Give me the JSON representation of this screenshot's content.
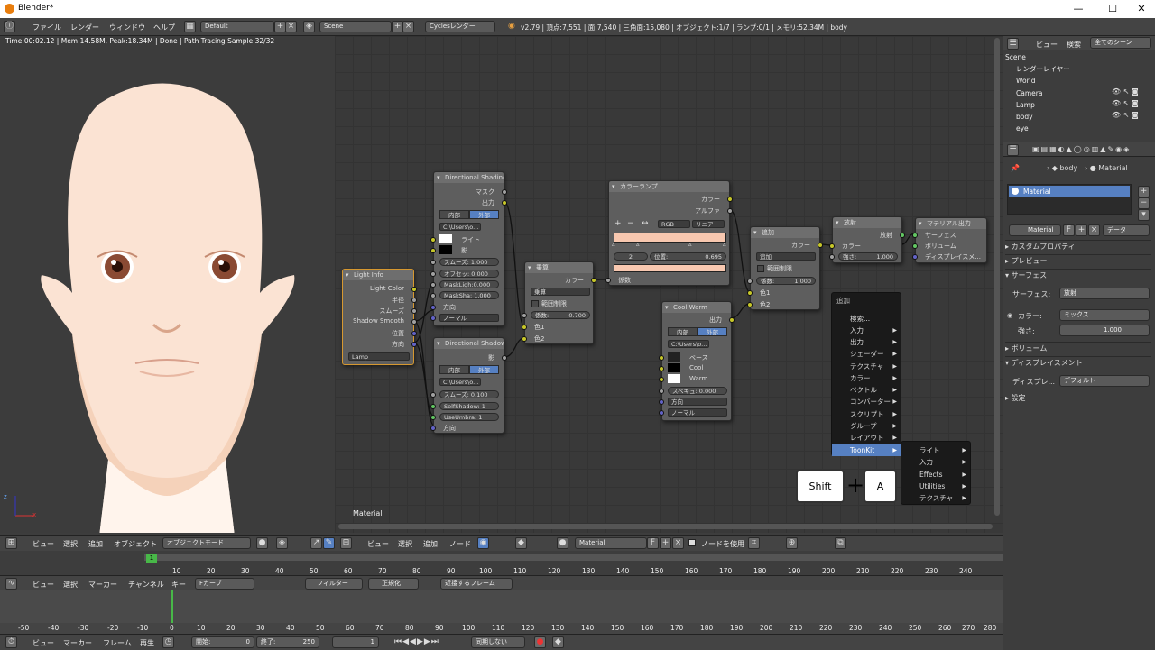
{
  "window": {
    "title": "Blender*",
    "minimize": "—",
    "maximize": "☐",
    "close": "✕"
  },
  "topbar": {
    "menus": [
      "ファイル",
      "レンダー",
      "ウィンドウ",
      "ヘルプ"
    ],
    "layout": "Default",
    "scene": "Scene",
    "engine": "Cyclesレンダー",
    "stats": "v2.79 | 頂点:7,551 | 面:7,540 | 三角面:15,080 | オブジェクト:1/7 | ランプ:0/1 | メモリ:52.34M | body"
  },
  "viewport": {
    "info": "Time:00:02.12 | Mem:14.58M, Peak:18.34M | Done | Path Tracing Sample 32/32",
    "axis_x": "x",
    "axis_z": "z"
  },
  "nodeeditor": {
    "label": "Material"
  },
  "nodes": {
    "dir_shading": {
      "title": "Directional Shading",
      "out1": "マスク",
      "out2": "出力",
      "tab_in": "内部",
      "tab_ext": "外部",
      "path": "C:\\Users\\o...",
      "light": "ライト",
      "shadow": "影",
      "f1": "スムーズ: 1.000",
      "f2": "オフセッ: 0.000",
      "f3": "MaskLigh:0.000",
      "f4": "MaskSha: 1.000",
      "dir": "方向",
      "normal": "ノーマル"
    },
    "light_info": {
      "title": "Light Info",
      "o1": "Light Color",
      "o2": "半径",
      "o3": "スムーズ",
      "o4": "Shadow Smooth",
      "o5": "位置",
      "o6": "方向",
      "lamp": "Lamp"
    },
    "dir_shadow": {
      "title": "Directional Shadow",
      "out": "影",
      "tab_in": "内部",
      "tab_ext": "外部",
      "path": "C:\\Users\\o...",
      "f1": "スムーズ: 0.100",
      "f2": "SelfShadow: 1",
      "f3": "UseUmbra: 1",
      "dir": "方向"
    },
    "multiply": {
      "title": "乗算",
      "out": "カラー",
      "mode": "乗算",
      "clamp": "範囲制限",
      "fac_label": "係数:",
      "fac": "0.700",
      "c1": "色1",
      "c2": "色2"
    },
    "ramp": {
      "title": "カラーランプ",
      "o1": "カラー",
      "o2": "アルファ",
      "mode": "RGB",
      "interp": "リニア",
      "idx": "2",
      "pos": "位置:",
      "posval": "0.695",
      "fac": "係数"
    },
    "coolwarm": {
      "title": "Cool Warm",
      "out": "出力",
      "tab_in": "内部",
      "tab_ext": "外部",
      "path": "C:\\Users\\o...",
      "base": "ベース",
      "cool": "Cool",
      "warm": "Warm",
      "spec": "スペキュ: 0.000",
      "dir": "方向",
      "normal": "ノーマル"
    },
    "add": {
      "title": "追加",
      "out": "カラー",
      "mode": "追加",
      "clamp": "範囲制限",
      "fac": "係数:",
      "facval": "1.000",
      "c1": "色1",
      "c2": "色2"
    },
    "emission": {
      "title": "放射",
      "out": "放射",
      "color": "カラー",
      "str": "強さ:",
      "strval": "1.000"
    },
    "matout": {
      "title": "マテリアル出力",
      "i1": "サーフェス",
      "i2": "ボリューム",
      "i3": "ディスプレイスメ..."
    }
  },
  "addmenu": {
    "title": "追加",
    "items": [
      "検索...",
      "入力",
      "出力",
      "シェーダー",
      "テクスチャ",
      "カラー",
      "ベクトル",
      "コンバーター",
      "スクリプト",
      "グループ",
      "レイアウト",
      "ToonKit"
    ]
  },
  "submenu": {
    "items": [
      "ライト",
      "入力",
      "Effects",
      "Utilities",
      "テクスチャ"
    ]
  },
  "keys": {
    "shift": "Shift",
    "plus": "+",
    "a": "A"
  },
  "outliner": {
    "tabs": [
      "ビュー",
      "検索",
      "全てのシーン"
    ],
    "rows": [
      "Scene",
      "レンダーレイヤー",
      "World",
      "Camera",
      "Lamp",
      "body",
      "eye"
    ]
  },
  "properties": {
    "bc1": "body",
    "bc2": "Material",
    "slot": "Material",
    "matname": "Material",
    "F": "F",
    "data": "データ",
    "panels": [
      "カスタムプロパティ",
      "プレビュー",
      "サーフェス",
      "ボリューム",
      "ディスプレイスメント"
    ],
    "surface_label": "サーフェス:",
    "surface_val": "放射",
    "color_label": "カラー:",
    "color_val": "ミックス",
    "str_label": "強さ:",
    "str_val": "1.000",
    "disp_label": "ディスプレ...",
    "disp_val": "デフォルト"
  },
  "vpheader": {
    "items": [
      "ビュー",
      "選択",
      "追加",
      "オブジェクト"
    ],
    "mode": "オブジェクトモード"
  },
  "neheader": {
    "items": [
      "ビュー",
      "選択",
      "追加",
      "ノード"
    ],
    "mat": "Material",
    "F": "F",
    "use_nodes": "ノードを使用"
  },
  "timeline": {
    "frame": "1",
    "ticks": [
      "10",
      "20",
      "30",
      "40",
      "50",
      "60",
      "70",
      "80",
      "90",
      "100",
      "110",
      "120",
      "130",
      "140",
      "150",
      "160",
      "170",
      "180",
      "190",
      "200",
      "210",
      "220",
      "230",
      "240"
    ]
  },
  "graph": {
    "items": [
      "ビュー",
      "選択",
      "マーカー",
      "チャンネル",
      "キー"
    ],
    "mode": "Fカーブ",
    "filter": "フィルター",
    "normalize": "正規化",
    "nearest": "近接するフレーム",
    "ticks": [
      "-50",
      "-40",
      "-30",
      "-20",
      "-10",
      "0",
      "10",
      "20",
      "30",
      "40",
      "50",
      "60",
      "70",
      "80",
      "90",
      "100",
      "110",
      "120",
      "130",
      "140",
      "150",
      "160",
      "170",
      "180",
      "190",
      "200",
      "210",
      "220",
      "230",
      "240",
      "250",
      "260",
      "270",
      "280"
    ]
  },
  "bottom": {
    "items": [
      "ビュー",
      "マーカー",
      "フレーム",
      "再生"
    ],
    "start": "開始:",
    "start_val": "0",
    "end": "終了:",
    "end_val": "250",
    "cur": "1",
    "sync": "同期しない"
  }
}
